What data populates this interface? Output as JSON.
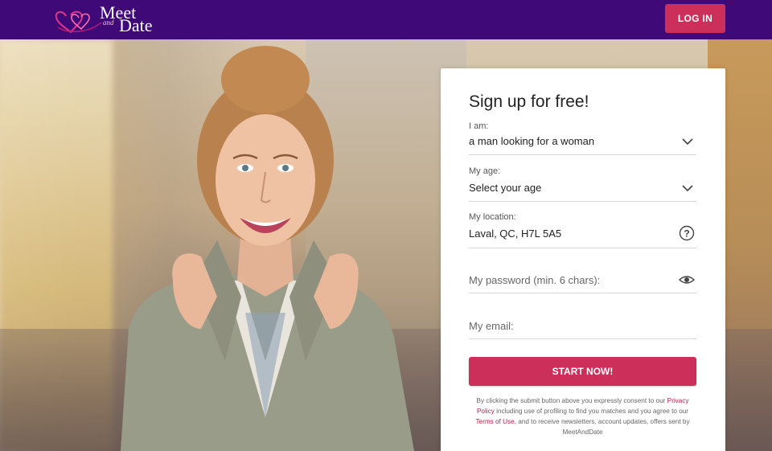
{
  "header": {
    "logo": {
      "meet": "Meet",
      "and": "and",
      "date": "Date"
    },
    "login_label": "LOG IN"
  },
  "signup": {
    "title": "Sign up for free!",
    "iam": {
      "label": "I am:",
      "value": "a man looking for a woman"
    },
    "age": {
      "label": "My age:",
      "value": "Select your age"
    },
    "location": {
      "label": "My location:",
      "value": "Laval, QC, H7L 5A5"
    },
    "password": {
      "placeholder": "My password (min. 6 chars):"
    },
    "email": {
      "placeholder": "My email:"
    },
    "submit_label": "START NOW!",
    "disclaimer": {
      "part1": "By clicking the submit button above you expressly consent to our ",
      "privacy_link": "Privacy Policy",
      "part2": " including use of profiling to find you matches and you agree to our ",
      "terms_link": "Terms of Use",
      "part3": ", and to receive newsletters, account updates, offers sent by MeetAndDate"
    }
  },
  "colors": {
    "header_bg": "#3f0a78",
    "accent": "#cc2f5a",
    "link": "#b0204c"
  },
  "icons": {
    "iam_chevron": "chevron-down-icon",
    "age_chevron": "chevron-down-icon",
    "location_help": "question-circle-icon",
    "password_toggle": "eye-icon"
  }
}
